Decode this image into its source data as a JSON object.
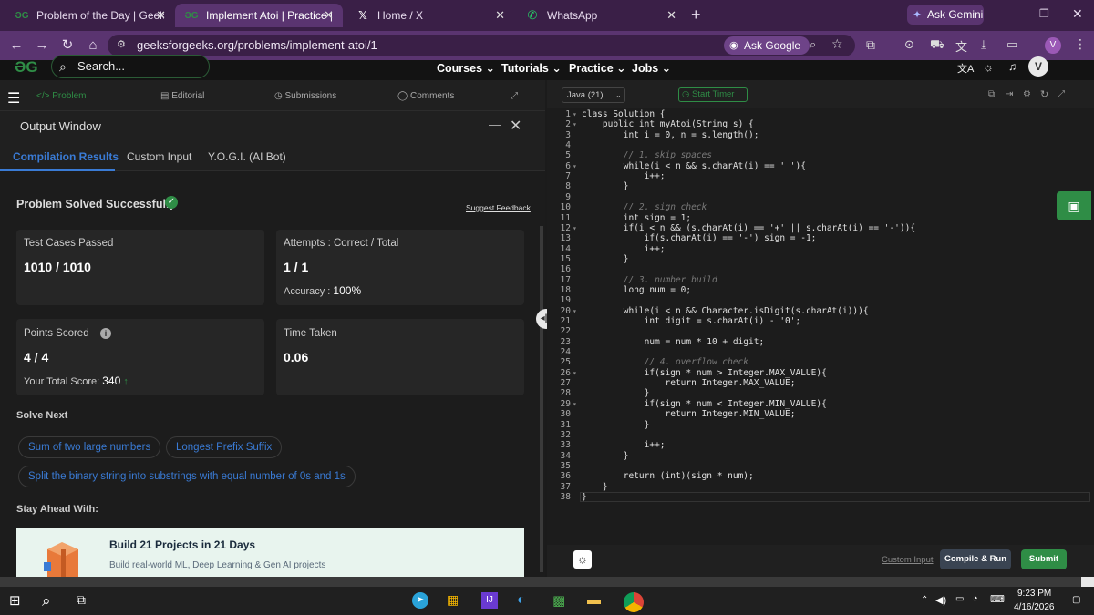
{
  "browser": {
    "tabs": [
      {
        "label": "Problem of the Day | GeeksforG",
        "icon": "gfg-icon",
        "active": false
      },
      {
        "label": "Implement Atoi | Practice | Gee",
        "icon": "gfg-icon",
        "active": true
      },
      {
        "label": "Home / X",
        "icon": "x-icon",
        "active": false
      },
      {
        "label": "WhatsApp",
        "icon": "whatsapp-icon",
        "active": false
      }
    ],
    "new_tab": "+",
    "ask_gemini": "Ask Gemini",
    "url": "geeksforgeeks.org/problems/implement-atoi/1",
    "ask_google": "Ask Google",
    "profile_initial": "V"
  },
  "site_header": {
    "search_placeholder": "Search...",
    "nav": [
      "Courses",
      "Tutorials",
      "Practice",
      "Jobs"
    ],
    "user_initial": "V"
  },
  "problem_tabs": [
    "Problem",
    "Editorial",
    "Submissions",
    "Comments"
  ],
  "output": {
    "title": "Output Window",
    "tabs": [
      "Compilation Results",
      "Custom Input",
      "Y.O.G.I. (AI Bot)"
    ],
    "status": "Problem Solved Successfully",
    "suggest_feedback": "Suggest Feedback",
    "test_cases_label": "Test Cases Passed",
    "test_cases_value": "1010 / 1010",
    "attempts_label": "Attempts : Correct / Total",
    "attempts_value": "1 / 1",
    "accuracy_label": "Accuracy :",
    "accuracy_value": "100%",
    "points_label": "Points Scored",
    "points_value": "4 / 4",
    "total_score_label": "Your Total Score:",
    "total_score_value": "340",
    "time_label": "Time Taken",
    "time_value": "0.06",
    "solve_next_heading": "Solve Next",
    "solve_next": [
      "Sum of two large numbers",
      "Longest Prefix Suffix",
      "Split the binary string into substrings with equal number of 0s and 1s"
    ],
    "stay_ahead_heading": "Stay Ahead With:",
    "promo_title": "Build 21 Projects in 21 Days",
    "promo_sub": "Build real-world ML, Deep Learning & Gen AI projects"
  },
  "editor": {
    "language": "Java (21)",
    "start_timer": "Start Timer",
    "code_lines": [
      "class Solution {",
      "    public int myAtoi(String s) {",
      "        int i = 0, n = s.length();",
      "",
      "        // 1. skip spaces",
      "        while(i < n && s.charAt(i) == ' '){",
      "            i++;",
      "        }",
      "",
      "        // 2. sign check",
      "        int sign = 1;",
      "        if(i < n && (s.charAt(i) == '+' || s.charAt(i) == '-')){",
      "            if(s.charAt(i) == '-') sign = -1;",
      "            i++;",
      "        }",
      "",
      "        // 3. number build",
      "        long num = 0;",
      "",
      "        while(i < n && Character.isDigit(s.charAt(i))){",
      "            int digit = s.charAt(i) - '0';",
      "",
      "            num = num * 10 + digit;",
      "",
      "            // 4. overflow check",
      "            if(sign * num > Integer.MAX_VALUE){",
      "                return Integer.MAX_VALUE;",
      "            }",
      "            if(sign * num < Integer.MIN_VALUE){",
      "                return Integer.MIN_VALUE;",
      "            }",
      "",
      "            i++;",
      "        }",
      "",
      "        return (int)(sign * num);",
      "    }",
      "}"
    ],
    "fold_lines": [
      1,
      2,
      6,
      12,
      20,
      26,
      29
    ],
    "custom_input": "Custom Input",
    "compile_run": "Compile & Run",
    "submit": "Submit"
  },
  "taskbar": {
    "time": "9:23 PM",
    "date": "4/16/2026"
  },
  "colors": {
    "gfg_green": "#2f8d46",
    "link_blue": "#3a7bd5",
    "tab_bar": "#3a1f47",
    "address_bar": "#5a3470"
  }
}
